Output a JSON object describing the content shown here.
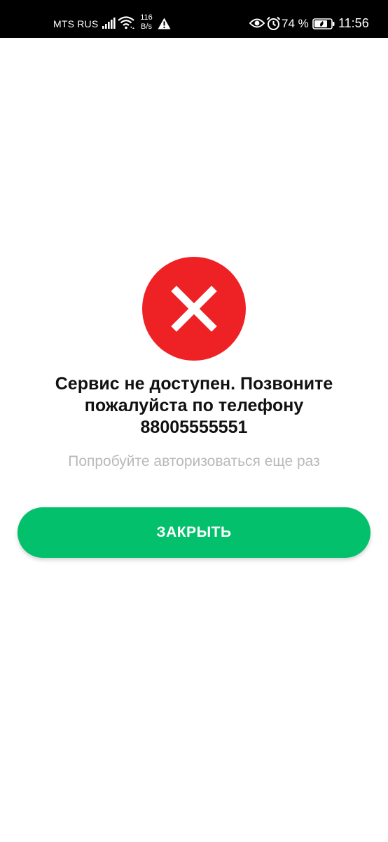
{
  "status_bar": {
    "carrier": "MTS RUS",
    "net_speed_value": "116",
    "net_speed_unit": "B/s",
    "battery_percent": "74 %",
    "time": "11:56"
  },
  "dialog": {
    "title_line1": "Сервис не доступен. Позвоните",
    "title_line2": "пожалуйста по телефону",
    "title_line3": "88005555551",
    "subtitle": "Попробуйте авторизоваться еще раз",
    "close_button_label": "ЗАКРЫТЬ"
  },
  "colors": {
    "error_red": "#ee2124",
    "button_green": "#02c06b",
    "subtitle_gray": "#b9b9b9"
  },
  "icons": {
    "status": [
      "signal-icon",
      "wifi-icon",
      "warning-icon",
      "eye-icon",
      "alarm-icon",
      "battery-icon"
    ],
    "error": "close-icon"
  }
}
